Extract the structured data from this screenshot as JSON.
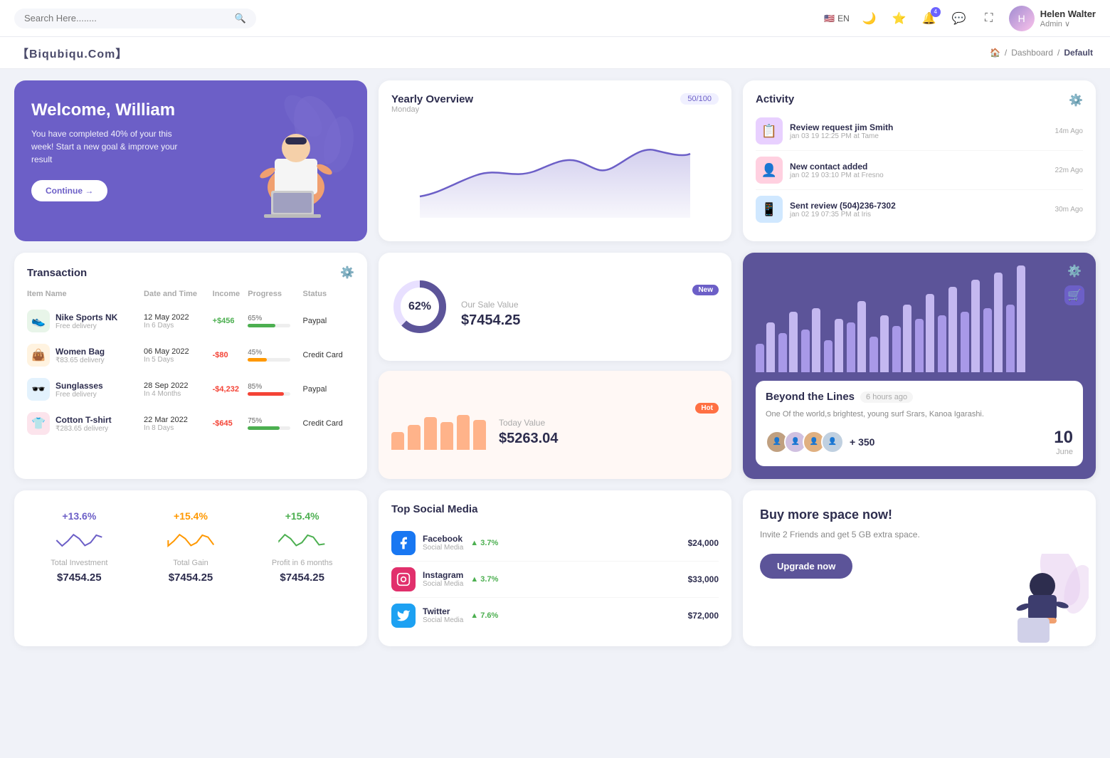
{
  "topnav": {
    "search_placeholder": "Search Here........",
    "lang": "EN",
    "user": {
      "name": "Helen Walter",
      "role": "Admin"
    },
    "notification_count": "4"
  },
  "breadcrumb": {
    "brand": "【Biqubiqu.Com】",
    "home_icon": "🏠",
    "items": [
      "Dashboard",
      "Default"
    ]
  },
  "welcome": {
    "title": "Welcome, William",
    "description": "You have completed 40% of your this week! Start a new goal & improve your result",
    "button": "Continue →"
  },
  "yearly_overview": {
    "title": "Yearly Overview",
    "subtitle": "Monday",
    "badge": "50/100"
  },
  "activity": {
    "title": "Activity",
    "items": [
      {
        "title": "Review request jim Smith",
        "subtitle": "jan 03 19 12:25 PM at Tame",
        "time": "14m Ago"
      },
      {
        "title": "New contact added",
        "subtitle": "jan 02 19 03:10 PM at Fresno",
        "time": "22m Ago"
      },
      {
        "title": "Sent review (504)236-7302",
        "subtitle": "jan 02 19 07:35 PM at Iris",
        "time": "30m Ago"
      }
    ]
  },
  "transaction": {
    "title": "Transaction",
    "columns": [
      "Item Name",
      "Date and Time",
      "Income",
      "Progress",
      "Status"
    ],
    "rows": [
      {
        "name": "Nike Sports NK",
        "sub": "Free delivery",
        "date": "12 May 2022",
        "days": "In 6 Days",
        "income": "+$456",
        "income_type": "pos",
        "progress": 65,
        "progress_color": "#4caf50",
        "status": "Paypal",
        "icon": "👟",
        "icon_bg": "#e8f5e9"
      },
      {
        "name": "Women Bag",
        "sub": "₹83.65 delivery",
        "date": "06 May 2022",
        "days": "In 5 Days",
        "income": "-$80",
        "income_type": "neg",
        "progress": 45,
        "progress_color": "#ff9800",
        "status": "Credit Card",
        "icon": "👜",
        "icon_bg": "#fff3e0"
      },
      {
        "name": "Sunglasses",
        "sub": "Free delivery",
        "date": "28 Sep 2022",
        "days": "In 4 Months",
        "income": "-$4,232",
        "income_type": "neg",
        "progress": 85,
        "progress_color": "#f44336",
        "status": "Paypal",
        "icon": "🕶️",
        "icon_bg": "#e3f2fd"
      },
      {
        "name": "Cotton T-shirt",
        "sub": "₹283.65 delivery",
        "date": "22 Mar 2022",
        "days": "In 8 Days",
        "income": "-$645",
        "income_type": "neg",
        "progress": 75,
        "progress_color": "#4caf50",
        "status": "Credit Card",
        "icon": "👕",
        "icon_bg": "#fce4ec"
      }
    ]
  },
  "sale_value": {
    "donut_pct": "62%",
    "title": "Our Sale Value",
    "value": "$7454.25",
    "badge": "New"
  },
  "today_value": {
    "title": "Today Value",
    "value": "$5263.04",
    "badge": "Hot",
    "bars": [
      35,
      50,
      65,
      55,
      70,
      60
    ]
  },
  "bar_chart": {
    "title": "Beyond the Lines",
    "time_ago": "6 hours ago",
    "description": "One Of the world,s brightest, young surf Srars, Kanoa Igarashi.",
    "plus_count": "+ 350",
    "date_num": "10",
    "date_month": "June",
    "bars": [
      [
        40,
        70
      ],
      [
        55,
        85
      ],
      [
        60,
        90
      ],
      [
        45,
        75
      ],
      [
        70,
        100
      ],
      [
        50,
        80
      ],
      [
        65,
        95
      ],
      [
        75,
        110
      ],
      [
        80,
        120
      ],
      [
        85,
        130
      ],
      [
        90,
        140
      ],
      [
        95,
        150
      ]
    ]
  },
  "mini_stats": {
    "items": [
      {
        "pct": "+13.6%",
        "pct_color": "#6c5fc7",
        "label": "Total Investment",
        "value": "$7454.25",
        "wave_color": "#6c5fc7"
      },
      {
        "pct": "+15.4%",
        "pct_color": "#ff9800",
        "label": "Total Gain",
        "value": "$7454.25",
        "wave_color": "#ff9800"
      },
      {
        "pct": "+15.4%",
        "pct_color": "#4caf50",
        "label": "Profit in 6 months",
        "value": "$7454.25",
        "wave_color": "#4caf50"
      }
    ]
  },
  "social_media": {
    "title": "Top Social Media",
    "items": [
      {
        "name": "Facebook",
        "type": "Social Media",
        "icon": "f",
        "icon_bg": "#1877f2",
        "pct": "3.7%",
        "amount": "$24,000"
      },
      {
        "name": "Instagram",
        "type": "Social Media",
        "icon": "ig",
        "icon_bg": "#e1306c",
        "pct": "3.7%",
        "amount": "$33,000"
      },
      {
        "name": "Twitter",
        "type": "Social Media",
        "icon": "tw",
        "icon_bg": "#1da1f2",
        "pct": "7.6%",
        "amount": "$72,000"
      }
    ]
  },
  "buy_space": {
    "title": "Buy more space now!",
    "description": "Invite 2 Friends and get 5 GB extra space.",
    "button": "Upgrade now"
  }
}
